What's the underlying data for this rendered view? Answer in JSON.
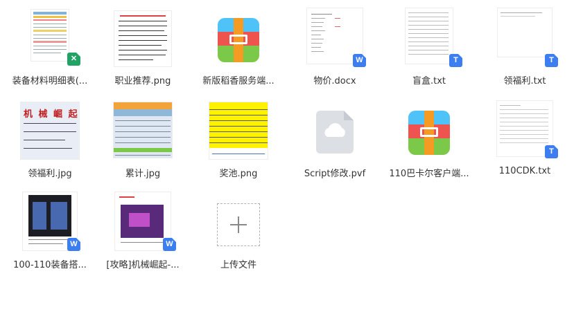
{
  "files": [
    {
      "name": "装备材料明细表(...",
      "icon": "excel-icon"
    },
    {
      "name": "职业推荐.png",
      "icon": "image-icon"
    },
    {
      "name": "新版稻香服务端...",
      "icon": "archive-icon"
    },
    {
      "name": "物价.docx",
      "icon": "word-icon"
    },
    {
      "name": "盲盒.txt",
      "icon": "text-icon"
    },
    {
      "name": "领福利.txt",
      "icon": "text-icon"
    },
    {
      "name": "领福利.jpg",
      "icon": "image-icon"
    },
    {
      "name": "累计.jpg",
      "icon": "image-icon"
    },
    {
      "name": "奖池.png",
      "icon": "image-icon"
    },
    {
      "name": "Script修改.pvf",
      "icon": "cloud-file-icon"
    },
    {
      "name": "110巴卡尔客户端...",
      "icon": "archive-icon"
    },
    {
      "name": "110CDK.txt",
      "icon": "text-icon"
    },
    {
      "name": "100-110装备搭...",
      "icon": "word-icon"
    },
    {
      "name": "[攻略]机械崛起-...",
      "icon": "word-icon"
    }
  ],
  "upload": {
    "label": "上传文件"
  },
  "thumbs": {
    "fuli_text": "机 械 崛 起 福"
  },
  "colors": {
    "excel": "#21a366",
    "word": "#3c7df0",
    "text": "#3c7df0",
    "archive_red": "#ef5350",
    "archive_green": "#7cc94a"
  }
}
